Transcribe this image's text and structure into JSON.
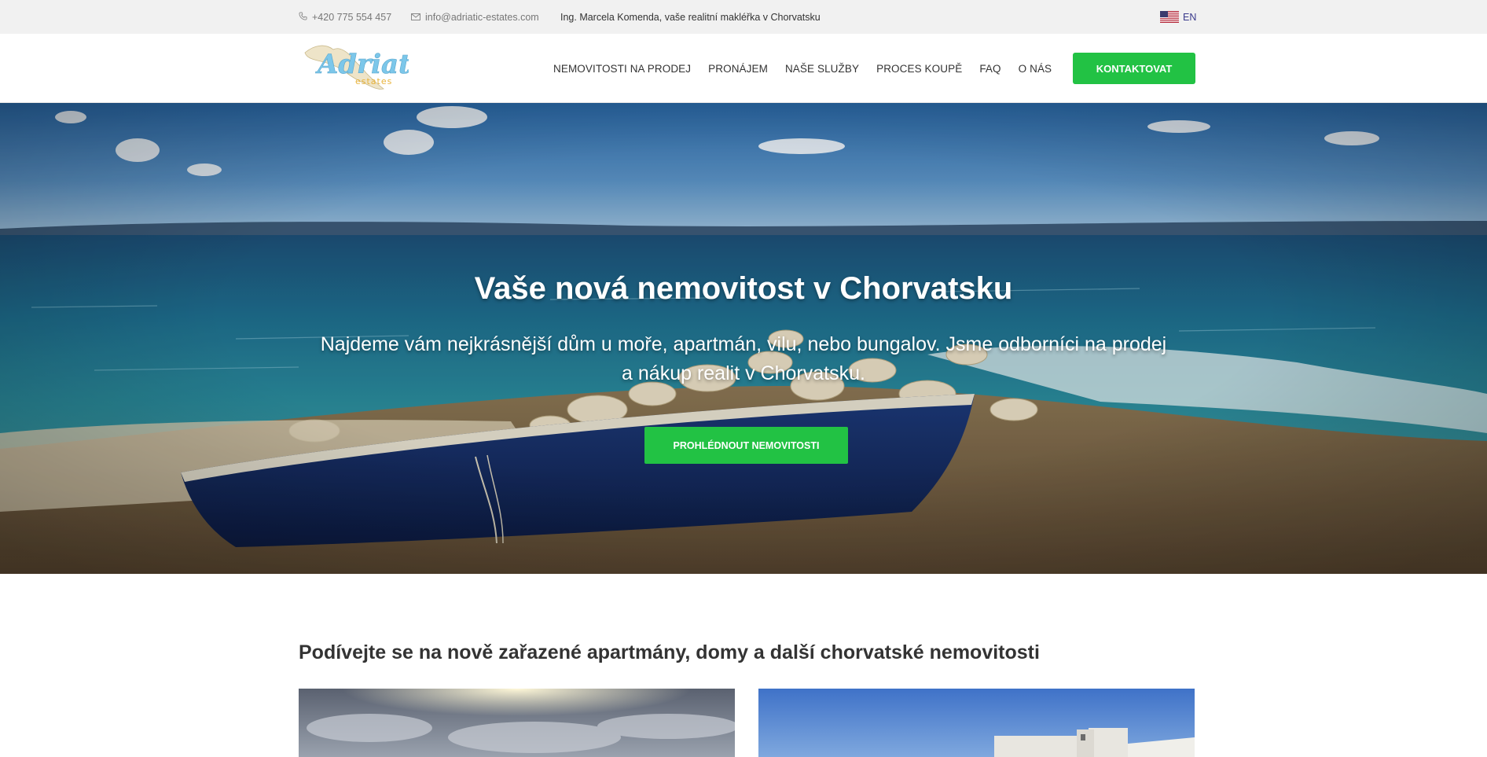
{
  "topbar": {
    "phone": "+420 775 554 457",
    "email": "info@adriatic-estates.com",
    "tagline": "Ing. Marcela Komenda, vaše realitní makléřka v Chorvatsku",
    "lang": "EN",
    "phone_icon": "phone-icon",
    "email_icon": "envelope-icon",
    "flag_icon": "us-flag-icon"
  },
  "header": {
    "logo_text": "Adriatic",
    "logo_sub": "estates",
    "nav": [
      {
        "label": "NEMOVITOSTI NA PRODEJ"
      },
      {
        "label": "PRONÁJEM"
      },
      {
        "label": "NAŠE SLUŽBY"
      },
      {
        "label": "PROCES KOUPĚ"
      },
      {
        "label": "FAQ"
      },
      {
        "label": "O NÁS"
      }
    ],
    "cta": "KONTAKTOVAT"
  },
  "hero": {
    "title": "Vaše nová nemovitost v Chorvatsku",
    "subtitle": "Najdeme vám nejkrásnější dům u moře, apartmán, vilu, nebo bungalov. Jsme odborníci na prodej a nákup realit v Chorvatsku.",
    "button": "PROHLÉDNOUT NEMOVITOSTI"
  },
  "listings": {
    "title": "Podívejte se na nově zařazené apartmány, domy a další chorvatské nemovitosti"
  },
  "colors": {
    "accent": "#22c244",
    "topbar_bg": "#f1f1f1",
    "text": "#333333"
  }
}
